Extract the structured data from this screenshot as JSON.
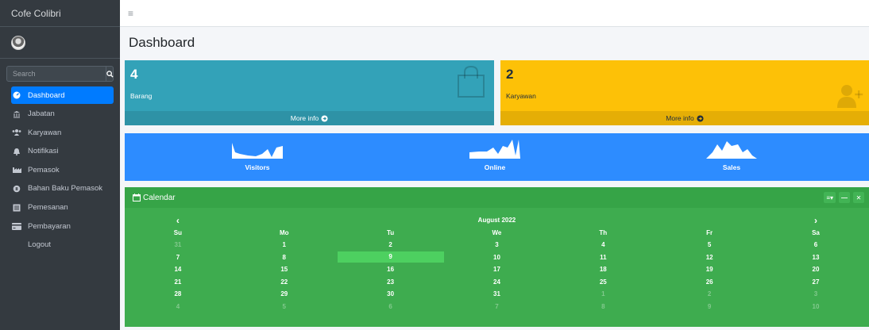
{
  "sidebar": {
    "brand": "Cofe Colibri",
    "search_placeholder": "Search",
    "items": [
      {
        "label": "Dashboard"
      },
      {
        "label": "Jabatan"
      },
      {
        "label": "Karyawan"
      },
      {
        "label": "Notifikasi"
      },
      {
        "label": "Pemasok"
      },
      {
        "label": "Bahan Baku Pemasok"
      },
      {
        "label": "Pemesanan"
      },
      {
        "label": "Pembayaran"
      },
      {
        "label": "Logout"
      }
    ]
  },
  "page": {
    "title": "Dashboard"
  },
  "boxes": [
    {
      "count": "4",
      "label": "Barang",
      "more": "More info",
      "color": "#33a2b8"
    },
    {
      "count": "2",
      "label": "Karyawan",
      "more": "More info",
      "color": "#fdc107"
    }
  ],
  "stats": [
    {
      "label": "Visitors"
    },
    {
      "label": "Online"
    },
    {
      "label": "Sales"
    }
  ],
  "calendar": {
    "title": "Calendar",
    "month": "August 2022",
    "prev": "‹",
    "next": "›",
    "weekdays": [
      "Su",
      "Mo",
      "Tu",
      "We",
      "Th",
      "Fr",
      "Sa"
    ],
    "weeks": [
      [
        "31",
        "1",
        "2",
        "3",
        "4",
        "5",
        "6"
      ],
      [
        "7",
        "8",
        "9",
        "10",
        "11",
        "12",
        "13"
      ],
      [
        "14",
        "15",
        "16",
        "17",
        "18",
        "19",
        "20"
      ],
      [
        "21",
        "22",
        "23",
        "24",
        "25",
        "26",
        "27"
      ],
      [
        "28",
        "29",
        "30",
        "31",
        "1",
        "2",
        "3"
      ],
      [
        "4",
        "5",
        "6",
        "7",
        "8",
        "9",
        "10"
      ]
    ],
    "selected": "9"
  }
}
